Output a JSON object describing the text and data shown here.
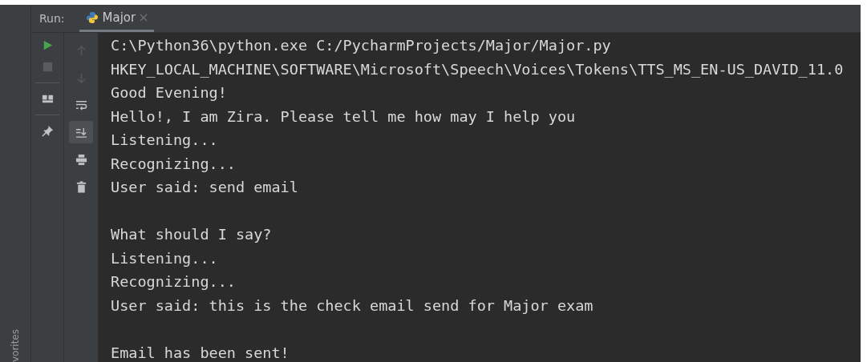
{
  "side_strip": {
    "label": "vorites"
  },
  "run_header": {
    "label": "Run:",
    "tabs": [
      {
        "label": "Major",
        "selected": true,
        "closable": true
      }
    ]
  },
  "toolbar_left": [
    {
      "kind": "run",
      "disabled": false
    },
    {
      "kind": "stop",
      "disabled": true
    },
    {
      "kind": "separator"
    },
    {
      "kind": "layout",
      "disabled": false
    },
    {
      "kind": "separator"
    },
    {
      "kind": "pin",
      "disabled": false
    }
  ],
  "toolbar_right": [
    {
      "kind": "up",
      "disabled": true,
      "selected": false
    },
    {
      "kind": "down",
      "disabled": true,
      "selected": false
    },
    {
      "kind": "wrap",
      "disabled": false,
      "selected": false
    },
    {
      "kind": "scroll-end",
      "disabled": false,
      "selected": true
    },
    {
      "kind": "print",
      "disabled": false,
      "selected": false
    },
    {
      "kind": "trash",
      "disabled": false,
      "selected": false
    }
  ],
  "console": {
    "blocks": [
      [
        "C:\\Python36\\python.exe C:/PycharmProjects/Major/Major.py",
        "HKEY_LOCAL_MACHINE\\SOFTWARE\\Microsoft\\Speech\\Voices\\Tokens\\TTS_MS_EN-US_DAVID_11.0",
        "Good Evening!",
        "Hello!, I am Zira. Please tell me how may I help you",
        "Listening...",
        "Recognizing...",
        "User said: send email"
      ],
      [
        "What should I say?",
        "Listening...",
        "Recognizing...",
        "User said: this is the check email send for Major exam"
      ],
      [
        "Email has been sent!"
      ]
    ]
  }
}
